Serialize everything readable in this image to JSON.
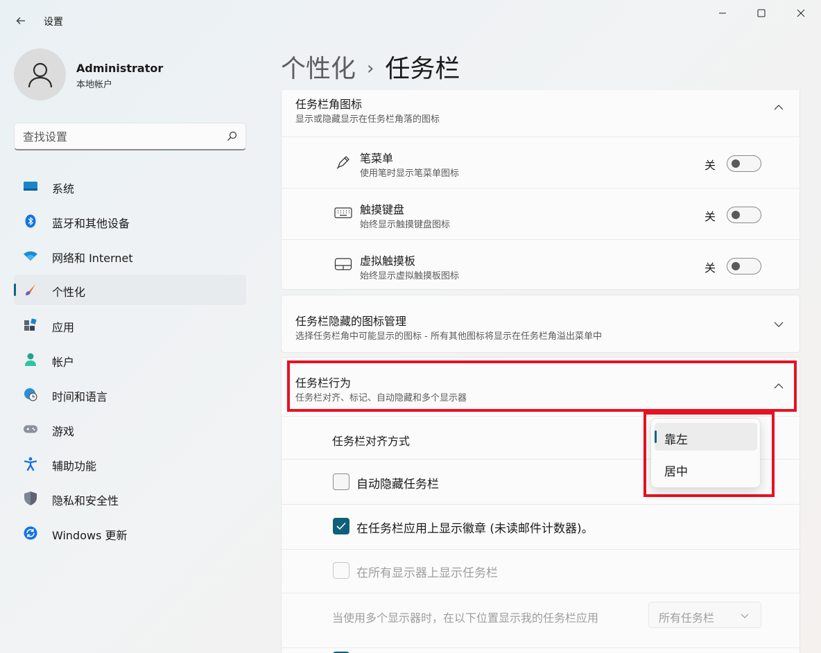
{
  "window": {
    "title": "设置",
    "minimize_icon": "minimize-icon",
    "maximize_icon": "maximize-icon",
    "close_icon": "close-icon"
  },
  "account": {
    "name": "Administrator",
    "type": "本地帐户"
  },
  "search": {
    "placeholder": "查找设置"
  },
  "nav": {
    "items": [
      {
        "label": "系统",
        "icon": "system-icon",
        "selected": false
      },
      {
        "label": "蓝牙和其他设备",
        "icon": "bluetooth-icon",
        "selected": false
      },
      {
        "label": "网络和 Internet",
        "icon": "wifi-icon",
        "selected": false
      },
      {
        "label": "个性化",
        "icon": "brush-icon",
        "selected": true
      },
      {
        "label": "应用",
        "icon": "apps-icon",
        "selected": false
      },
      {
        "label": "帐户",
        "icon": "account-icon",
        "selected": false
      },
      {
        "label": "时间和语言",
        "icon": "globe-clock-icon",
        "selected": false
      },
      {
        "label": "游戏",
        "icon": "gamepad-icon",
        "selected": false
      },
      {
        "label": "辅助功能",
        "icon": "accessibility-icon",
        "selected": false
      },
      {
        "label": "隐私和安全性",
        "icon": "shield-icon",
        "selected": false
      },
      {
        "label": "Windows 更新",
        "icon": "update-icon",
        "selected": false
      }
    ]
  },
  "breadcrumb": {
    "parent": "个性化",
    "separator": "›",
    "current": "任务栏"
  },
  "corner_icons": {
    "title": "任务栏角图标",
    "subtitle": "显示或隐藏显示在任务栏角落的图标",
    "items": [
      {
        "title": "笔菜单",
        "subtitle": "使用笔时显示笔菜单图标",
        "state": "关",
        "icon": "pen-icon"
      },
      {
        "title": "触摸键盘",
        "subtitle": "始终显示触摸键盘图标",
        "state": "关",
        "icon": "keyboard-icon"
      },
      {
        "title": "虚拟触摸板",
        "subtitle": "始终显示虚拟触摸板图标",
        "state": "关",
        "icon": "touchpad-icon"
      }
    ]
  },
  "overflow": {
    "title": "任务栏隐藏的图标管理",
    "subtitle": "选择任务栏角中可能显示的图标 - 所有其他图标将显示在任务栏角溢出菜单中"
  },
  "behaviors": {
    "title": "任务栏行为",
    "subtitle": "任务栏对齐、标记、自动隐藏和多个显示器",
    "alignment_label": "任务栏对齐方式",
    "alignment_options": [
      "靠左",
      "居中"
    ],
    "alignment_selected": "靠左",
    "autohide_label": "自动隐藏任务栏",
    "autohide_checked": false,
    "badges_label": "在任务栏应用上显示徽章 (未读邮件计数器)。",
    "badges_checked": true,
    "all_displays_label": "在所有显示器上显示任务栏",
    "all_displays_checked": false,
    "multi_label": "当使用多个显示器时，在以下位置显示我的任务栏应用",
    "multi_value": "所有任务栏"
  },
  "colors": {
    "accent": "#0f6384",
    "highlight": "#e81123"
  }
}
